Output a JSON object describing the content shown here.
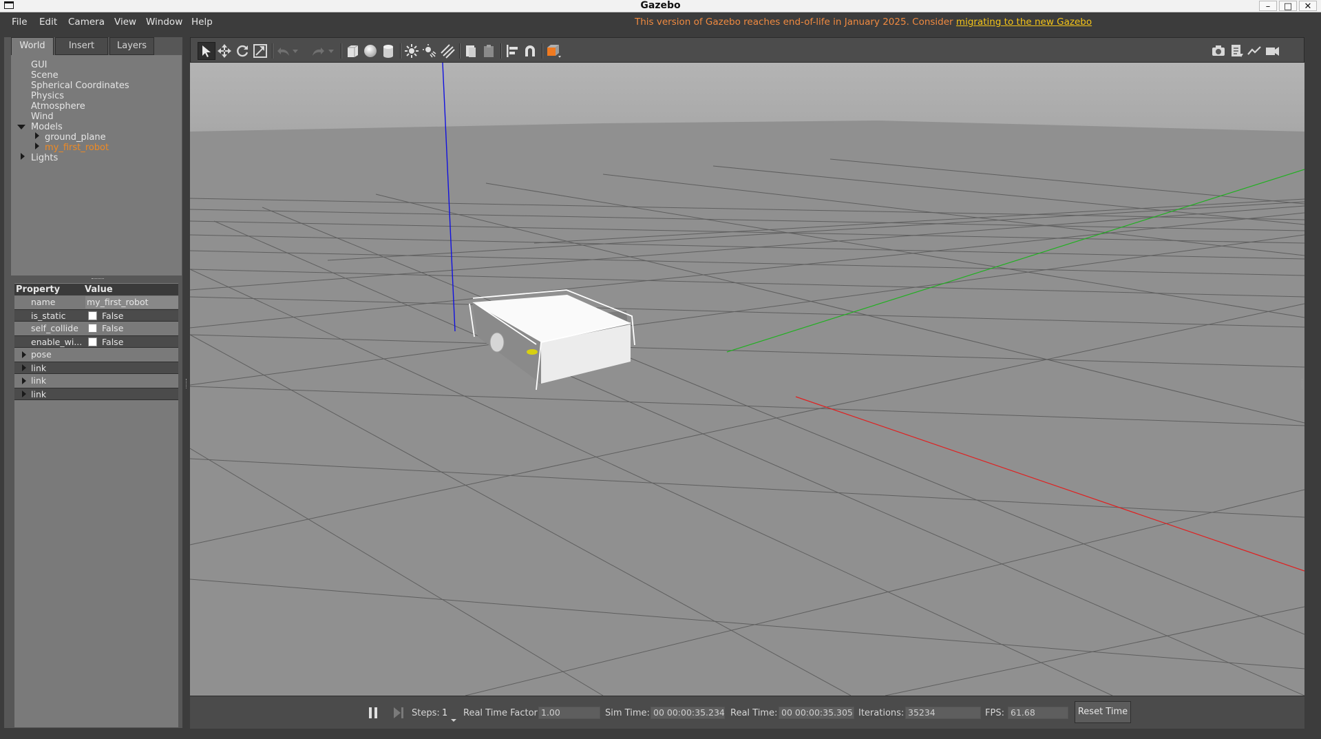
{
  "window": {
    "title": "Gazebo",
    "controls": {
      "minimize": "–",
      "maximize": "□",
      "close": "✕"
    }
  },
  "menubar": {
    "items": [
      "File",
      "Edit",
      "Camera",
      "View",
      "Window",
      "Help"
    ],
    "eol_notice": "This version of Gazebo reaches end-of-life in January 2025. Consider",
    "eol_link": "migrating to the new Gazebo"
  },
  "left_panel": {
    "tabs": [
      "World",
      "Insert",
      "Layers"
    ],
    "active_tab": "World",
    "tree": [
      {
        "label": "GUI",
        "level": 0,
        "expander": "none"
      },
      {
        "label": "Scene",
        "level": 0,
        "expander": "none"
      },
      {
        "label": "Spherical Coordinates",
        "level": 0,
        "expander": "none"
      },
      {
        "label": "Physics",
        "level": 0,
        "expander": "none"
      },
      {
        "label": "Atmosphere",
        "level": 0,
        "expander": "none"
      },
      {
        "label": "Wind",
        "level": 0,
        "expander": "none"
      },
      {
        "label": "Models",
        "level": 0,
        "expander": "expanded"
      },
      {
        "label": "ground_plane",
        "level": 1,
        "expander": "collapsed"
      },
      {
        "label": "my_first_robot",
        "level": 1,
        "expander": "collapsed",
        "selected": true
      },
      {
        "label": "Lights",
        "level": 0,
        "expander": "collapsed"
      }
    ],
    "properties": {
      "header": {
        "property": "Property",
        "value": "Value"
      },
      "rows": [
        {
          "key": "name",
          "value": "my_first_robot",
          "type": "text"
        },
        {
          "key": "is_static",
          "value": "False",
          "type": "checkbox"
        },
        {
          "key": "self_collide",
          "value": "False",
          "type": "checkbox"
        },
        {
          "key": "enable_wi...",
          "value": "False",
          "type": "checkbox"
        },
        {
          "key": "pose",
          "type": "group"
        },
        {
          "key": "link",
          "type": "group"
        },
        {
          "key": "link",
          "type": "group"
        },
        {
          "key": "link",
          "type": "group"
        }
      ]
    }
  },
  "toolbar": {
    "tools": [
      "select-mode",
      "translate-mode",
      "rotate-mode",
      "scale-mode",
      "undo",
      "undo-history",
      "redo",
      "redo-history",
      "box-shape",
      "sphere-shape",
      "cylinder-shape",
      "point-light",
      "spot-light",
      "directional-light",
      "copy",
      "paste",
      "align",
      "snap",
      "view-angle"
    ],
    "right_tools": [
      "screenshot",
      "log",
      "plot",
      "record-video"
    ],
    "active_tool": "select-mode"
  },
  "bottom_bar": {
    "steps_label": "Steps:",
    "steps_value": "1",
    "rtf_label": "Real Time Factor:",
    "rtf_value": "1.00",
    "sim_time_label": "Sim Time:",
    "sim_time_value": "00 00:00:35.234",
    "real_time_label": "Real Time:",
    "real_time_value": "00 00:00:35.305",
    "iterations_label": "Iterations:",
    "iterations_value": "35234",
    "fps_label": "FPS:",
    "fps_value": "61.68",
    "reset_label": "Reset Time"
  },
  "colors": {
    "eol_text": "#f08a40",
    "eol_link": "#f5c518",
    "selected_model": "#f08a22",
    "axis_x": "#e02020",
    "axis_y": "#20c020",
    "axis_z": "#1010e0"
  }
}
